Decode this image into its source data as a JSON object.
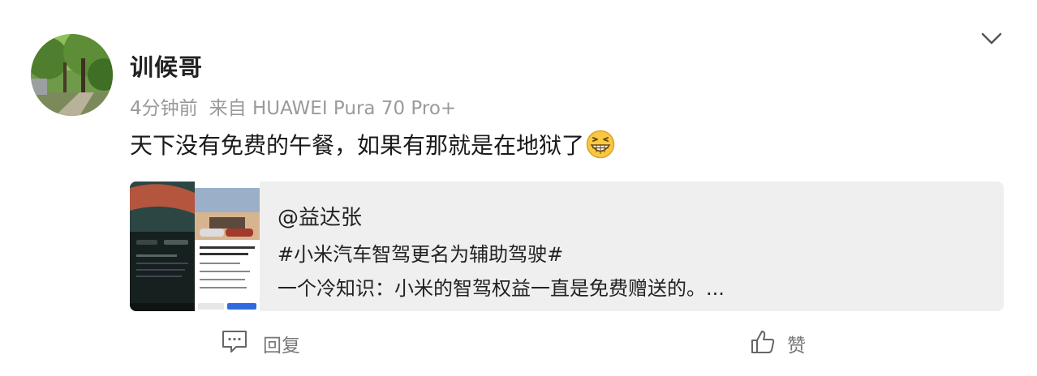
{
  "post": {
    "username": "训候哥",
    "time": "4分钟前",
    "source": "来自 HUAWEI Pura 70 Pro+",
    "text": "天下没有免费的午餐，如果有那就是在地狱了",
    "emoji": "grin-emoji"
  },
  "repost_card": {
    "mention": "@益达张",
    "topic": "#小米汽车智驾更名为辅助驾驶#",
    "description": "一个冷知识：小米的智驾权益一直是免费赠送的。..."
  },
  "actions": {
    "reply_label": "回复",
    "like_label": "赞"
  },
  "icons": [
    "chevron-down-icon",
    "comment-icon",
    "thumbs-up-icon"
  ],
  "colors": {
    "meta_gray": "#9a9a9a",
    "card_bg": "#efefef",
    "action_gray": "#777777"
  }
}
